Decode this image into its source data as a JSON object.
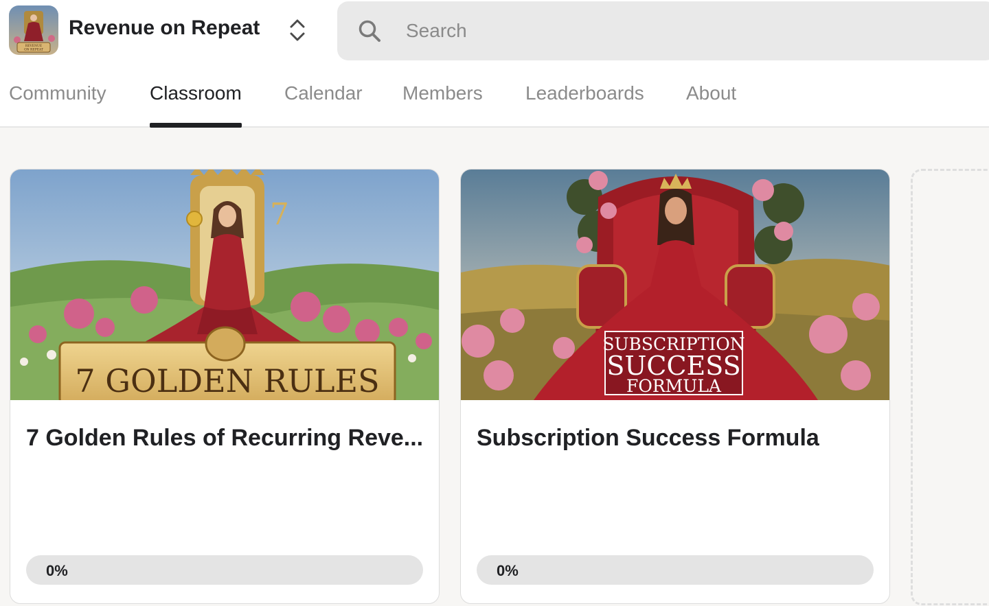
{
  "group": {
    "name": "Revenue on Repeat",
    "logo_caption": "REVENUE ON REPEAT",
    "switch_icon": "chevron-up-down-icon"
  },
  "search": {
    "placeholder": "Search",
    "icon": "search-icon"
  },
  "nav": {
    "tabs": [
      {
        "label": "Community",
        "active": false
      },
      {
        "label": "Classroom",
        "active": true
      },
      {
        "label": "Calendar",
        "active": false
      },
      {
        "label": "Members",
        "active": false
      },
      {
        "label": "Leaderboards",
        "active": false
      },
      {
        "label": "About",
        "active": false
      }
    ]
  },
  "courses": [
    {
      "title": "7 Golden Rules of Recurring Reve...",
      "cover_text": "7 GOLDEN RULES",
      "cover_number": "7",
      "progress": 0,
      "progress_label": "0%"
    },
    {
      "title": "Subscription Success Formula",
      "cover_text_lines": [
        "SUBSCRIPTION",
        "SUCCESS",
        "FORMULA"
      ],
      "progress": 0,
      "progress_label": "0%"
    }
  ],
  "colors": {
    "accent": "#202124",
    "tab_inactive": "#8b8b8b",
    "progress_track": "#e4e4e4",
    "gown_red": "#a8232d",
    "gold": "#d8b46a"
  }
}
